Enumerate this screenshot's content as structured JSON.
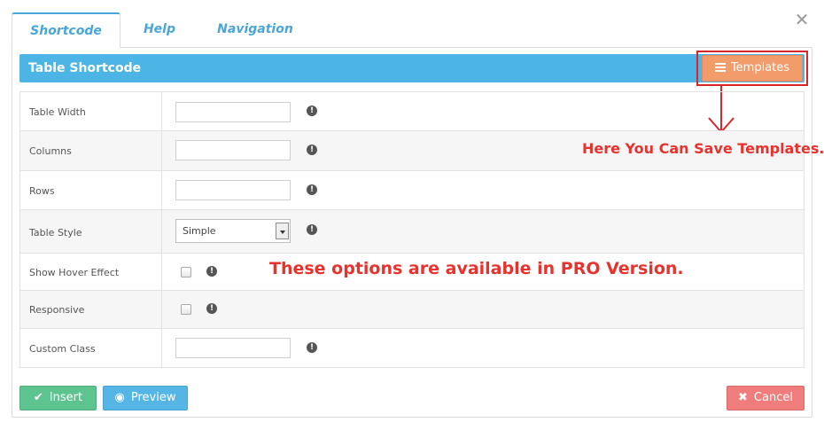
{
  "tabs": [
    {
      "label": "Shortcode",
      "active": true
    },
    {
      "label": "Help",
      "active": false
    },
    {
      "label": "Navigation",
      "active": false
    }
  ],
  "close_icon": "close-icon",
  "header": {
    "title": "Table Shortcode",
    "templates_label": "Templates",
    "bar_color": "#4cb5e6",
    "templates_color": "#f29b6b"
  },
  "fields": [
    {
      "label": "Table Width",
      "type": "text",
      "value": ""
    },
    {
      "label": "Columns",
      "type": "text",
      "value": ""
    },
    {
      "label": "Rows",
      "type": "text",
      "value": ""
    },
    {
      "label": "Table Style",
      "type": "select",
      "value": "Simple"
    },
    {
      "label": "Show Hover Effect",
      "type": "checkbox",
      "checked": false
    },
    {
      "label": "Responsive",
      "type": "checkbox",
      "checked": false
    },
    {
      "label": "Custom Class",
      "type": "text",
      "value": ""
    }
  ],
  "info_glyph": "!",
  "annotations": {
    "templates_note": "Here You Can Save Templates.",
    "pro_note": "These options are available in PRO Version.",
    "color": "#e8322e"
  },
  "footer": {
    "insert_label": "Insert",
    "preview_label": "Preview",
    "cancel_label": "Cancel",
    "insert_color": "#5dc48f",
    "preview_color": "#55b6e6",
    "cancel_color": "#ee7d7b"
  }
}
